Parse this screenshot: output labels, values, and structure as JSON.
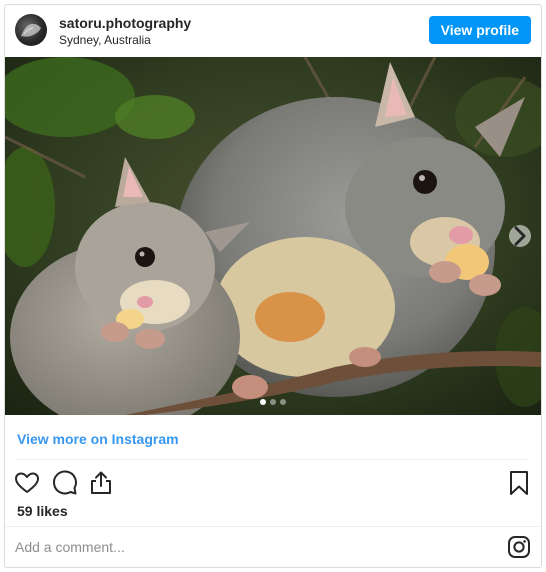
{
  "header": {
    "username": "satoru.photography",
    "location": "Sydney, Australia",
    "view_profile_label": "View profile"
  },
  "media": {
    "carousel_count": 3,
    "active_index": 0,
    "next_icon": "chevron-right-icon"
  },
  "links": {
    "view_more_label": "View more on Instagram"
  },
  "actions": {
    "icons": [
      "heart-icon",
      "comment-icon",
      "share-icon",
      "bookmark-icon"
    ]
  },
  "stats": {
    "likes_label": "59 likes"
  },
  "comment": {
    "placeholder": "Add a comment...",
    "instagram_icon": "instagram-icon"
  },
  "colors": {
    "accent": "#0095f6",
    "link": "#3897f0",
    "text": "#262626",
    "border": "#dbdbdb"
  }
}
